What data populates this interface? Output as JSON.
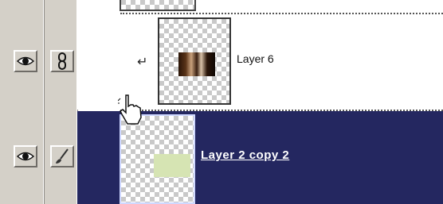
{
  "layers": {
    "top_partial": {
      "name": ""
    },
    "layer_6": {
      "name": "Layer 6",
      "clipping_indicator": "clip-arrow-icon",
      "visible": true,
      "linked": true
    },
    "selected": {
      "name": "Layer 2 copy 2",
      "visible": true,
      "brush_active": true,
      "swatch_color": "#d6e4b3"
    }
  },
  "glyphs": {
    "clip_arrow": "↵"
  },
  "colors": {
    "panel_bg": "#d4d0c8",
    "selection_bg": "#242760",
    "checker": "#c9c9c9"
  }
}
